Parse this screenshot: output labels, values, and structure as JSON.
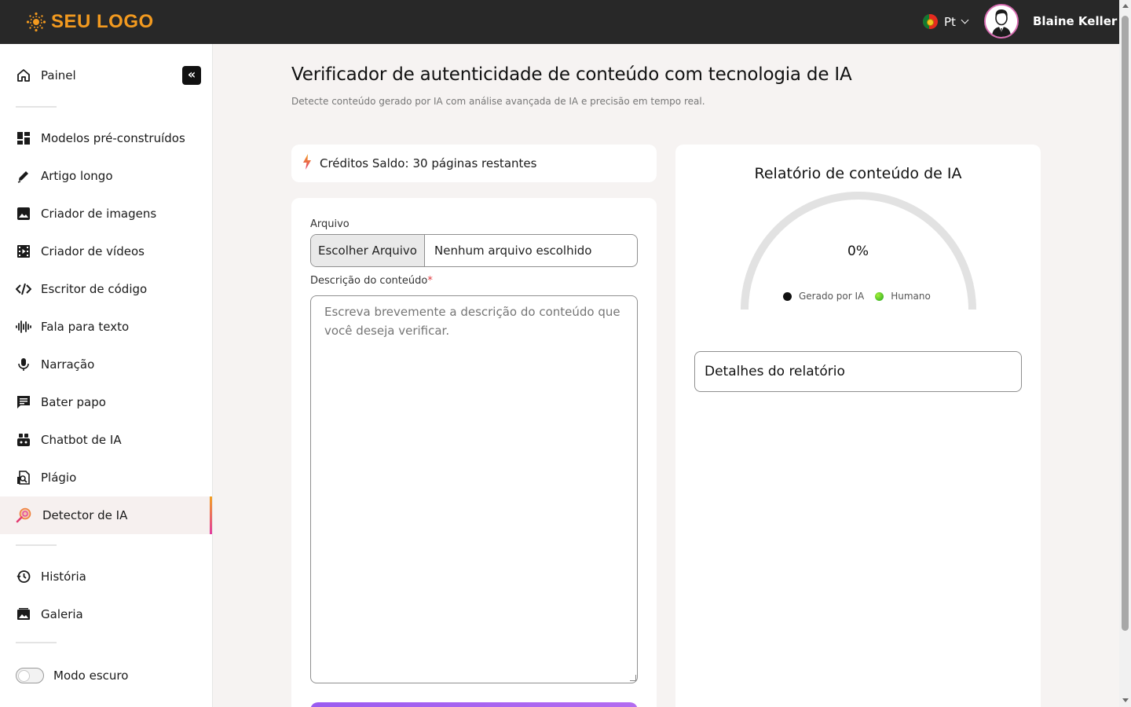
{
  "header": {
    "logo_text": "SEU LOGO",
    "language": "Pt",
    "user_name": "Blaine Keller"
  },
  "sidebar": {
    "items": [
      {
        "label": "Painel",
        "icon": "home-icon"
      },
      {
        "label": "Modelos pré-construídos",
        "icon": "dashboard-icon"
      },
      {
        "label": "Artigo longo",
        "icon": "pencil-icon"
      },
      {
        "label": "Criador de imagens",
        "icon": "image-icon"
      },
      {
        "label": "Criador de vídeos",
        "icon": "video-icon"
      },
      {
        "label": "Escritor de código",
        "icon": "code-icon"
      },
      {
        "label": "Fala para texto",
        "icon": "waveform-icon"
      },
      {
        "label": "Narração",
        "icon": "microphone-icon"
      },
      {
        "label": "Bater papo",
        "icon": "chat-icon"
      },
      {
        "label": "Chatbot de IA",
        "icon": "robot-icon"
      },
      {
        "label": "Plágio",
        "icon": "plagiarism-icon"
      },
      {
        "label": "Detector de IA",
        "icon": "magnifier-icon",
        "active": true
      },
      {
        "label": "História",
        "icon": "history-icon"
      },
      {
        "label": "Galeria",
        "icon": "gallery-icon"
      }
    ],
    "collapse_glyph": "«",
    "dark_mode_label": "Modo escuro",
    "dark_mode_on": false
  },
  "main": {
    "title": "Verificador de autenticidade de conteúdo com tecnologia de IA",
    "subtitle": "Detecte conteúdo gerado por IA com análise avançada de IA e precisão em tempo real.",
    "credits": {
      "prefix": "Créditos Saldo:",
      "value": "30 páginas restantes"
    },
    "form": {
      "file_label": "Arquivo",
      "file_button": "Escolher Arquivo",
      "file_status": "Nenhum arquivo escolhido",
      "description_label": "Descrição do conteúdo",
      "required_mark": "*",
      "description_placeholder": "Escreva brevemente a descrição do conteúdo que você deseja verificar."
    },
    "report": {
      "title": "Relatório de conteúdo de IA",
      "percent": "0%",
      "legend_ai": "Gerado por IA",
      "legend_human": "Humano",
      "details_label": "Detalhes do relatório"
    }
  },
  "colors": {
    "topbar": "#282828",
    "logo": "#f39a1f",
    "accent_gradient_start": "#f2a020",
    "accent_gradient_end": "#e23aa0",
    "submit": "#a064f0"
  }
}
